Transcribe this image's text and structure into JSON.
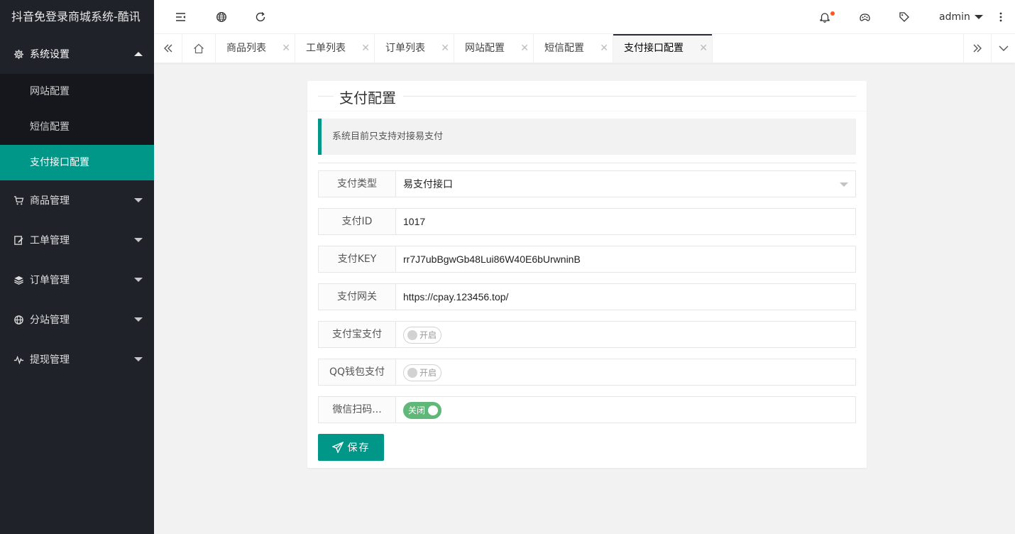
{
  "app": {
    "title": "抖音免登录商城系统-酷讯"
  },
  "sidebar": {
    "groups": [
      {
        "label": "系统设置",
        "icon": "gear-icon",
        "open": true,
        "items": [
          {
            "label": "网站配置"
          },
          {
            "label": "短信配置"
          },
          {
            "label": "支付接口配置",
            "active": true
          }
        ]
      },
      {
        "label": "商品管理",
        "icon": "cart-icon"
      },
      {
        "label": "工单管理",
        "icon": "edit-icon"
      },
      {
        "label": "订单管理",
        "icon": "layers-icon"
      },
      {
        "label": "分站管理",
        "icon": "globe-icon"
      },
      {
        "label": "提现管理",
        "icon": "pulse-icon"
      }
    ]
  },
  "header": {
    "user": "admin"
  },
  "tabs": [
    {
      "label": "商品列表"
    },
    {
      "label": "工单列表"
    },
    {
      "label": "订单列表"
    },
    {
      "label": "网站配置"
    },
    {
      "label": "短信配置"
    },
    {
      "label": "支付接口配置",
      "active": true
    }
  ],
  "form": {
    "title": "支付配置",
    "notice": "系统目前只支持对接易支付",
    "fields": [
      {
        "label": "支付类型",
        "value": "易支付接口"
      },
      {
        "label": "支付ID",
        "value": "1017"
      },
      {
        "label": "支付KEY",
        "value": "rr7J7ubBgwGb48Lui86W40E6bUrwninB"
      },
      {
        "label": "支付网关",
        "value": "https://cpay.123456.top/"
      }
    ],
    "switches": [
      {
        "label": "支付宝支付",
        "text": "开启",
        "on": false
      },
      {
        "label": "QQ钱包支付",
        "text": "开启",
        "on": false
      },
      {
        "label": "微信扫码...",
        "text": "关闭",
        "on": true
      }
    ],
    "save_label": "保存"
  },
  "colors": {
    "accent": "#009688",
    "sidebar": "#20222a",
    "switch_on": "#5fb878",
    "badge": "#ff5722"
  }
}
